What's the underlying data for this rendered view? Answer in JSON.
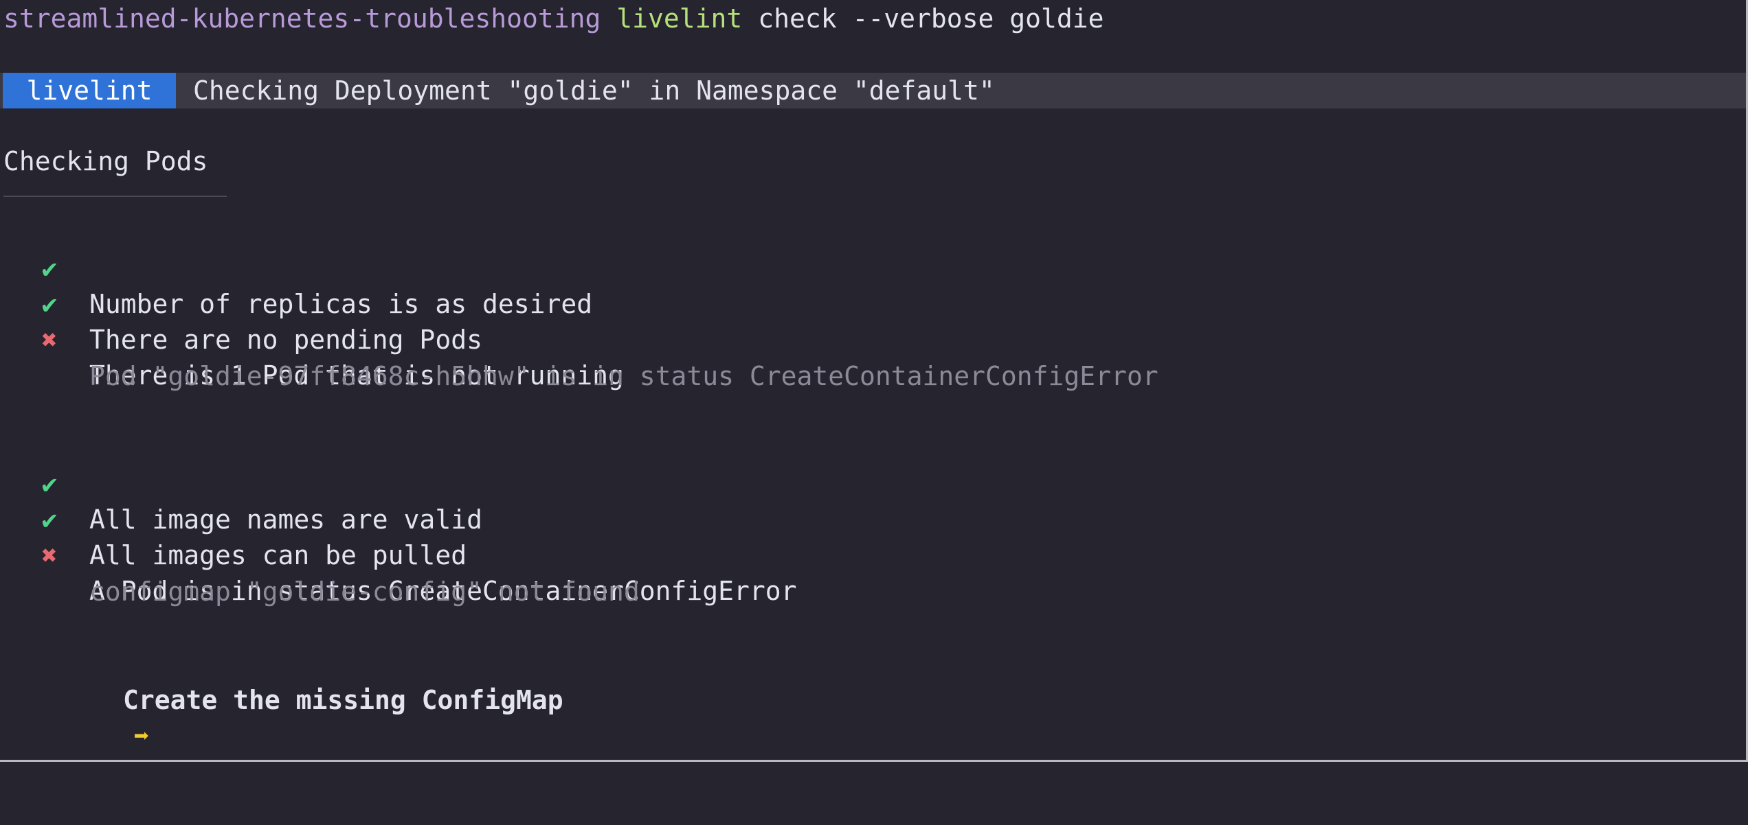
{
  "prompt": {
    "directory": "streamlined-kubernetes-troubleshooting",
    "command": "livelint",
    "arguments": "check --verbose goldie"
  },
  "banner": {
    "badge": "livelint",
    "message": "Checking Deployment \"goldie\" in Namespace \"default\""
  },
  "section": {
    "title": "Checking Pods"
  },
  "checks": [
    {
      "status": "ok",
      "icon": "✔",
      "text": "Number of replicas is as desired"
    },
    {
      "status": "ok",
      "icon": "✔",
      "text": "There are no pending Pods"
    },
    {
      "status": "fail",
      "icon": "✖",
      "text": "There is 1 Pod that is not running"
    },
    {
      "status": "ok",
      "icon": "✔",
      "text": "All image names are valid"
    },
    {
      "status": "ok",
      "icon": "✔",
      "text": "All images can be pulled"
    },
    {
      "status": "fail",
      "icon": "✖",
      "text": "A Pod is in status CreateContainerConfigError"
    }
  ],
  "details": [
    "Pod \"goldie-97ff8468c-h5hhw\" is in status CreateContainerConfigError",
    "configmap \"goldie-config\" not found"
  ],
  "fix": {
    "icon": "➡",
    "text": "Create the missing ConfigMap"
  },
  "colors": {
    "background": "#25242f",
    "badge": "#2f73d8",
    "ok": "#52d38a",
    "fail": "#e86a70",
    "arrow": "#f2cc2e",
    "directory": "#b89ad8",
    "command": "#b5e07a"
  }
}
